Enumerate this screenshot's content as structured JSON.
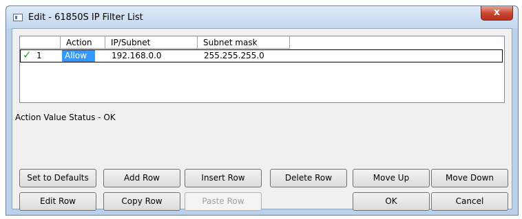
{
  "window": {
    "title": "Edit - 61850S IP Filter List",
    "close_glyph": "x"
  },
  "grid": {
    "columns": [
      "",
      "Action",
      "IP/Subnet",
      "Subnet mask"
    ],
    "rows": [
      {
        "selected": true,
        "check": "✓",
        "num": "1",
        "action": "Allow",
        "ip": "192.168.0.0",
        "mask": "255.255.255.0"
      }
    ]
  },
  "status": "Action Value Status - OK",
  "buttons": {
    "set_defaults": "Set to Defaults",
    "add_row": "Add Row",
    "insert_row": "Insert Row",
    "delete_row": "Delete Row",
    "move_up": "Move Up",
    "move_down": "Move Down",
    "edit_row": "Edit Row",
    "copy_row": "Copy Row",
    "paste_row": "Paste Row",
    "ok": "OK",
    "cancel": "Cancel"
  },
  "colors": {
    "selection": "#3399ff",
    "check": "#2a9a2a",
    "close": "#c8422c"
  }
}
